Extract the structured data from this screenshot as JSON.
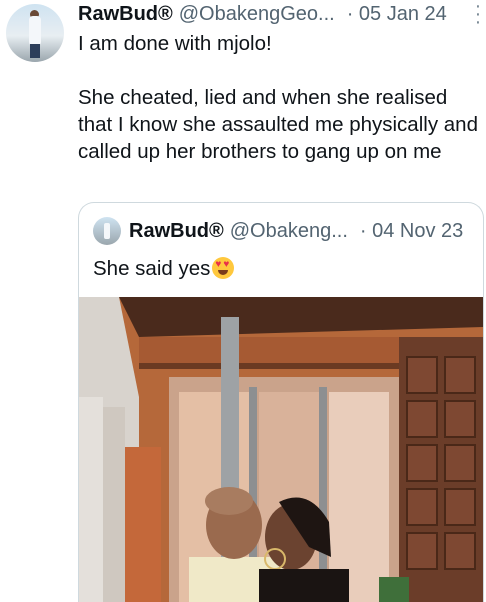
{
  "tweet": {
    "author_name": "RawBud®",
    "author_handle": "@ObakengGeo...",
    "date": "· 05 Jan 24",
    "text": "I am done with mjolo!\n\nShe cheated, lied and when she realised that I know she assaulted me physically and called up her brothers to gang up on me"
  },
  "quoted_tweet": {
    "author_name": "RawBud®",
    "author_handle": "@Obakeng...",
    "date": "· 04 Nov 23",
    "text": "She said yes",
    "emoji": "smiling-face-with-heart-eyes"
  },
  "icons": {
    "more": "more-vertical-icon"
  }
}
